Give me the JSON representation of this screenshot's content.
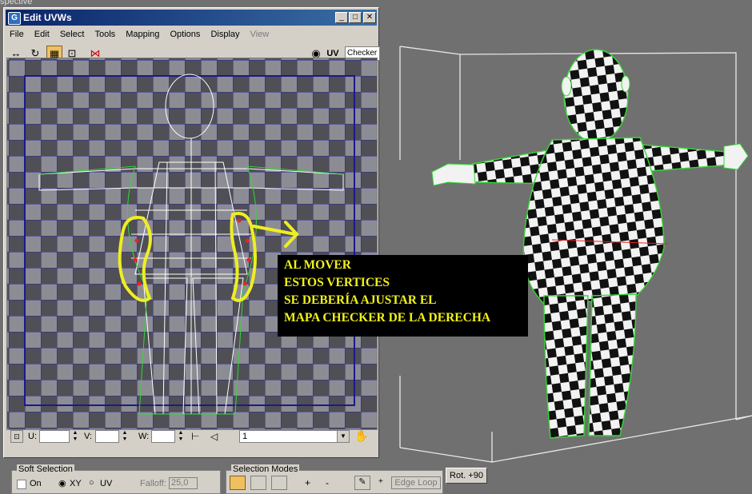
{
  "viewport": {
    "label": "spective"
  },
  "window": {
    "title": "Edit UVWs",
    "minimize": "_",
    "maximize": "□",
    "close": "✕"
  },
  "menu": [
    "File",
    "Edit",
    "Select",
    "Tools",
    "Mapping",
    "Options",
    "Display",
    "View"
  ],
  "toolbar": {
    "uv_label": "UV",
    "map_dropdown": "Checker"
  },
  "bottom": {
    "u_label": "U:",
    "v_label": "V:",
    "w_label": "W:",
    "channel_value": "1"
  },
  "soft_selection": {
    "group_label": "Soft Selection",
    "on_label": "On",
    "xy_label": "XY",
    "uv_label": "UV",
    "falloff_label": "Falloff:",
    "falloff_value": "25,0"
  },
  "selection_modes": {
    "group_label": "Selection Modes",
    "edge_loop_label": "Edge Loop"
  },
  "rotate_button": "Rot. +90",
  "annotation": [
    "AL MOVER",
    "ESTOS VERTICES",
    "SE DEBERÍA AJUSTAR EL",
    "MAPA CHECKER DE LA DERECHA"
  ],
  "colors": {
    "viewport_bg": "#707070",
    "annotation_text": "#f2f21a",
    "highlight_yellow": "#eeee22",
    "uv_frame": "#1a1a8a",
    "mesh_green": "#35d835",
    "vertex_red": "#ee2222"
  }
}
